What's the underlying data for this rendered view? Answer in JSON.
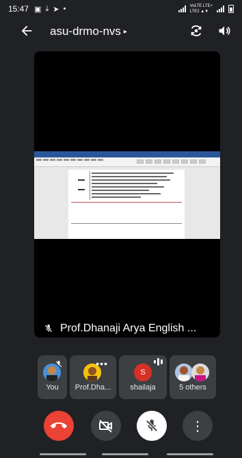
{
  "status_bar": {
    "time": "15:47",
    "network_label_top": "VoLTE LTE+",
    "network_label_bottom": "LTE2 ▲▼"
  },
  "top_bar": {
    "meeting_name": "asu-drmo-nvs",
    "caret": "▸"
  },
  "main_tile": {
    "presenter_label": "Prof.Dhanaji Arya English ..."
  },
  "participants": [
    {
      "label": "You",
      "avatar_color": "#1a73e8"
    },
    {
      "label": "Prof.Dha...",
      "avatar_color": "#fbbc04",
      "menu": "•••"
    },
    {
      "label": "shailaja",
      "initial": "S",
      "avatar_color": "#d93025"
    },
    {
      "label": "5 others"
    }
  ],
  "controls": {
    "end_call_color": "#ea4335",
    "more_glyph": "⋮"
  },
  "colors": {
    "background": "#202124",
    "tile": "#000000",
    "chip": "#3c4043",
    "control_dark": "#3c4043",
    "control_light": "#ffffff"
  }
}
